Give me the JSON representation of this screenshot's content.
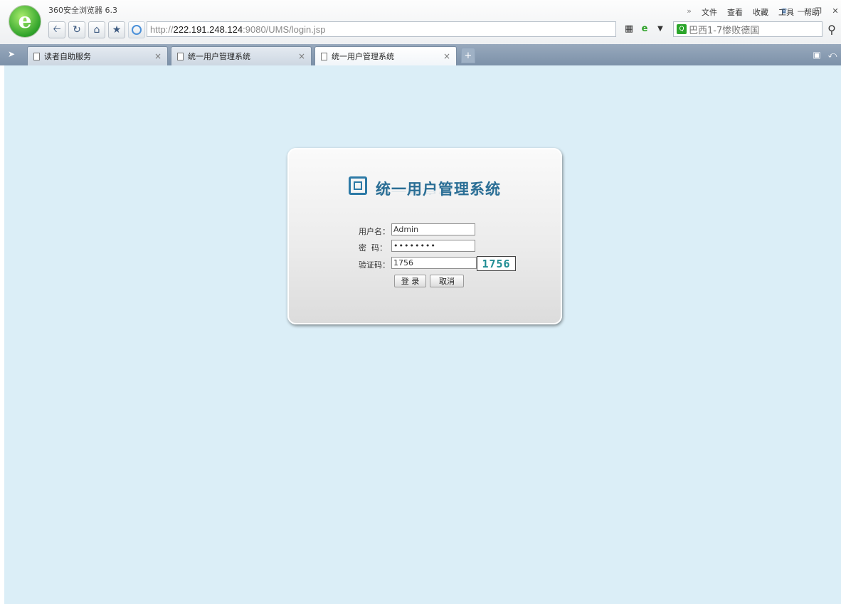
{
  "browser": {
    "app_title": "360安全浏览器 6.3",
    "address": {
      "protocol": "http://",
      "host": "222.191.248.124",
      "rest": ":9080/UMS/login.jsp"
    },
    "menu": [
      "文件",
      "查看",
      "收藏",
      "工具",
      "帮助"
    ],
    "menu_expand": "»",
    "search": {
      "value": "巴西1-7惨败德国",
      "engine_icon": "search-engine-icon"
    },
    "window_controls": [
      "skin-icon",
      "minimize-icon",
      "restore-icon",
      "close-icon"
    ]
  },
  "tabs": [
    {
      "label": "读者自助服务",
      "active": false
    },
    {
      "label": "统一用户管理系统",
      "active": false
    },
    {
      "label": "统一用户管理系统",
      "active": true
    }
  ],
  "tab_close": "×",
  "tab_new": "+",
  "login": {
    "system_title": "统一用户管理系统",
    "username_label": "用户名：",
    "username_value": "Admin",
    "password_label": "密  码：",
    "password_value": "••••••••",
    "captcha_label": "验证码：",
    "captcha_value": "1756",
    "captcha_image_text": "1756",
    "login_button": "登 录",
    "cancel_button": "取消"
  },
  "colors": {
    "page_background": "#dbeef7",
    "tab_strip": "#8ca0b6",
    "title_accent": "#2a6e95",
    "captcha_text": "#1f8d93"
  }
}
